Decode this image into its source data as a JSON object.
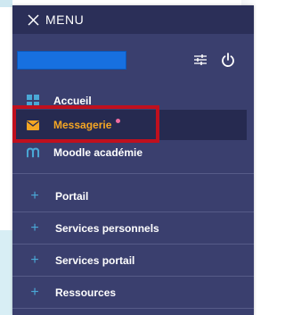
{
  "header": {
    "menu_label": "MENU"
  },
  "nav": {
    "items": [
      {
        "label": "Accueil",
        "icon": "grid-icon"
      },
      {
        "label": "Messagerie",
        "icon": "envelope-icon",
        "active": true,
        "has_notification": true
      },
      {
        "label": "Moodle académie",
        "icon": "moodle-icon"
      }
    ]
  },
  "sections": [
    {
      "label": "Portail"
    },
    {
      "label": "Services personnels"
    },
    {
      "label": "Services portail"
    },
    {
      "label": "Ressources"
    }
  ],
  "colors": {
    "panel_bg": "#3a3f6e",
    "topbar_bg": "#2b2f58",
    "active_bg": "#262a50",
    "active_text": "#f5a623",
    "plus_color": "#4aa8d6",
    "notification_dot": "#f06ba0",
    "highlight_border": "#c0101e",
    "user_box": "#1770e0"
  }
}
